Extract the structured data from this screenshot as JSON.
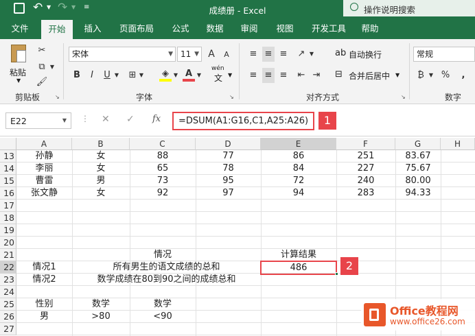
{
  "app": {
    "title": "成绩册 - Excel",
    "search_placeholder": "操作说明搜索"
  },
  "tabs": [
    "文件",
    "开始",
    "插入",
    "页面布局",
    "公式",
    "数据",
    "审阅",
    "视图",
    "开发工具",
    "帮助"
  ],
  "ribbon": {
    "clipboard": {
      "paste_label": "粘贴",
      "group_label": "剪贴板"
    },
    "font": {
      "font_name": "宋体",
      "font_size": "11",
      "group_label": "字体",
      "grow": "A",
      "shrink": "A",
      "bold": "B",
      "italic": "I",
      "underline": "U",
      "wen": "wén",
      "wen_char": "文"
    },
    "alignment": {
      "wrap_label": "自动换行",
      "merge_label": "合并后居中",
      "group_label": "对齐方式"
    },
    "number": {
      "format": "常规",
      "group_label": "数字",
      "percent": "%",
      "comma": ","
    }
  },
  "formula_bar": {
    "name_box": "E22",
    "fx": "fx",
    "formula": "=DSUM(A1:G16,C1,A25:A26)"
  },
  "columns": [
    "A",
    "B",
    "C",
    "D",
    "E",
    "F",
    "G",
    "H"
  ],
  "rows": [
    {
      "n": "13",
      "cells": [
        "孙静",
        "女",
        "88",
        "77",
        "86",
        "251",
        "83.67",
        ""
      ]
    },
    {
      "n": "14",
      "cells": [
        "李丽",
        "女",
        "65",
        "78",
        "84",
        "227",
        "75.67",
        ""
      ]
    },
    {
      "n": "15",
      "cells": [
        "曹雷",
        "男",
        "73",
        "95",
        "72",
        "240",
        "80.00",
        ""
      ]
    },
    {
      "n": "16",
      "cells": [
        "张文静",
        "女",
        "92",
        "97",
        "94",
        "283",
        "94.33",
        ""
      ]
    },
    {
      "n": "17",
      "cells": [
        "",
        "",
        "",
        "",
        "",
        "",
        "",
        ""
      ]
    },
    {
      "n": "18",
      "cells": [
        "",
        "",
        "",
        "",
        "",
        "",
        "",
        ""
      ]
    },
    {
      "n": "19",
      "cells": [
        "",
        "",
        "",
        "",
        "",
        "",
        "",
        ""
      ]
    },
    {
      "n": "20",
      "cells": [
        "",
        "",
        "",
        "",
        "",
        "",
        "",
        ""
      ]
    },
    {
      "n": "21",
      "cells": [
        "",
        "",
        "情况",
        "",
        "计算结果",
        "",
        "",
        ""
      ]
    },
    {
      "n": "22",
      "cells": [
        "情况1",
        "所有男生的语文成绩的总和",
        "",
        "",
        "486",
        "",
        "",
        ""
      ]
    },
    {
      "n": "23",
      "cells": [
        "情况2",
        "数学成绩在80到90之间的成绩总和",
        "",
        "",
        "",
        "",
        "",
        ""
      ]
    },
    {
      "n": "24",
      "cells": [
        "",
        "",
        "",
        "",
        "",
        "",
        "",
        ""
      ]
    },
    {
      "n": "25",
      "cells": [
        "性别",
        "数学",
        "数学",
        "",
        "",
        "",
        "",
        ""
      ]
    },
    {
      "n": "26",
      "cells": [
        "男",
        ">80",
        "<90",
        "",
        "",
        "",
        "",
        ""
      ]
    },
    {
      "n": "27",
      "cells": [
        "",
        "",
        "",
        "",
        "",
        "",
        "",
        ""
      ]
    }
  ],
  "annotations": {
    "badge1": "1",
    "badge2": "2"
  },
  "watermark": {
    "brand": "Office教程网",
    "url": "www.office26.com"
  },
  "colors": {
    "accent": "#217346",
    "highlight": "#e8444a"
  }
}
